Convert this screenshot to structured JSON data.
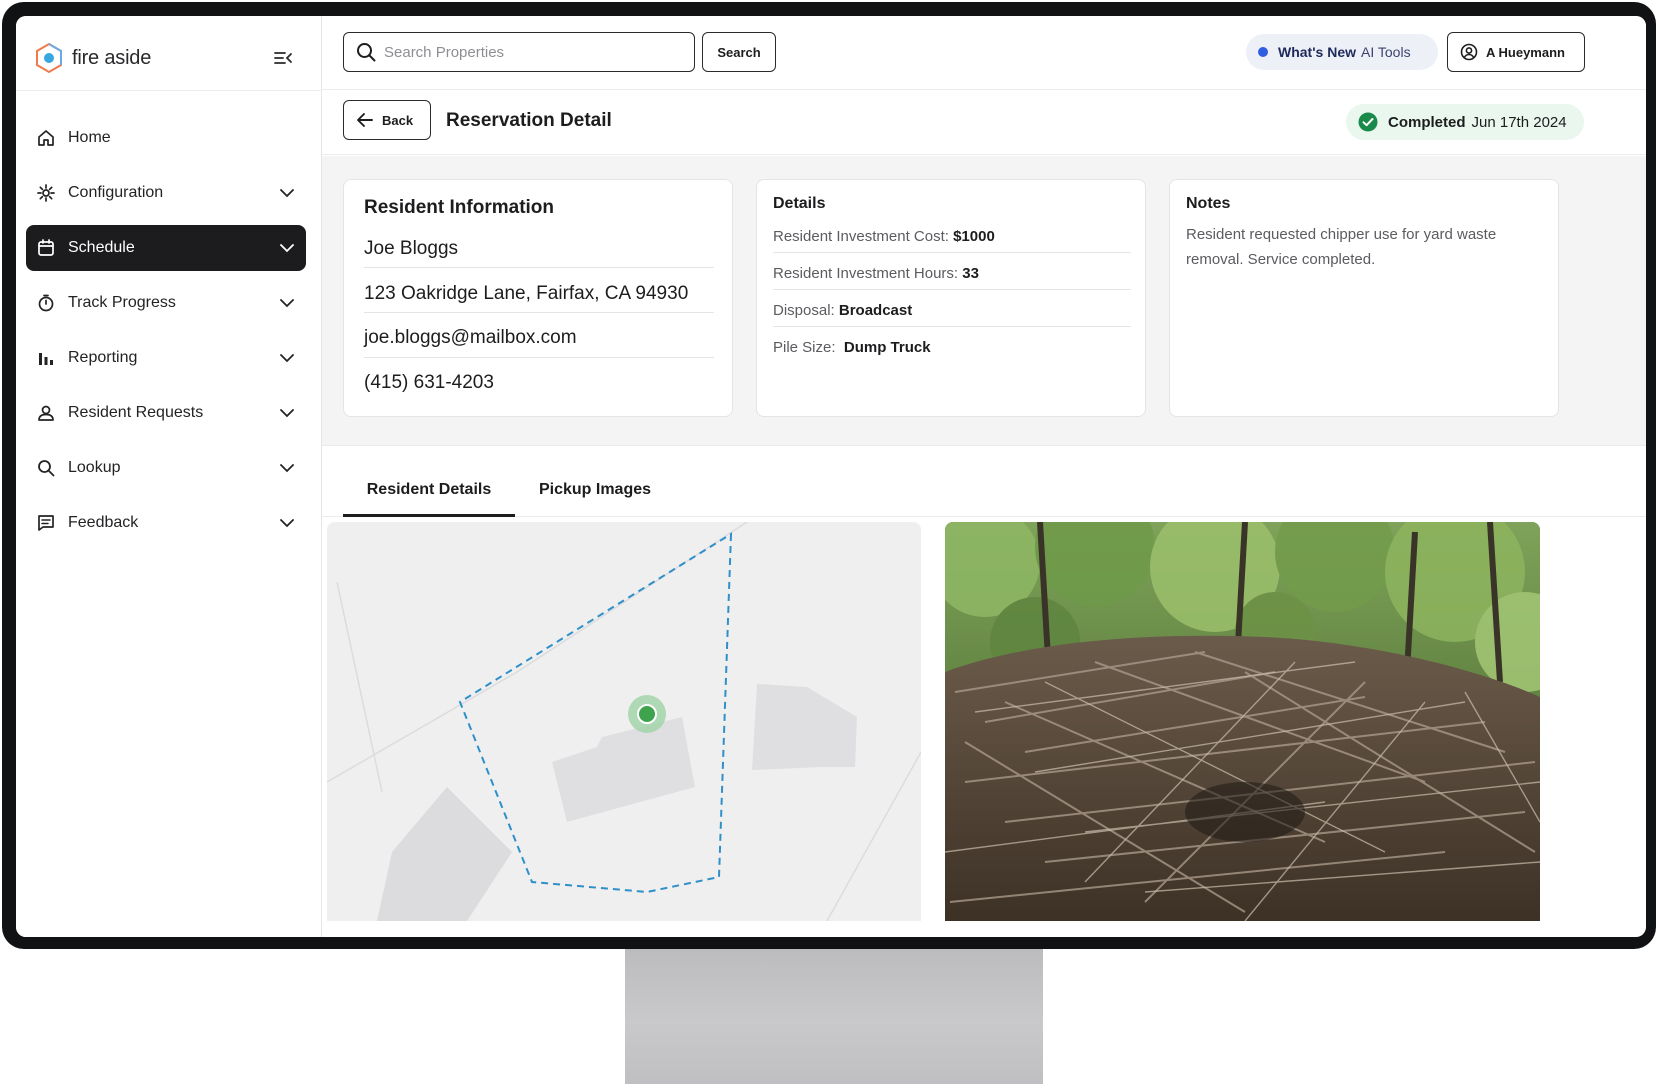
{
  "brand": {
    "name": "fire aside"
  },
  "sidebar": {
    "items": [
      {
        "label": "Home",
        "icon": "home-icon",
        "has_chevron": false
      },
      {
        "label": "Configuration",
        "icon": "gear-icon",
        "has_chevron": true
      },
      {
        "label": "Schedule",
        "icon": "calendar-icon",
        "has_chevron": true,
        "active": true
      },
      {
        "label": "Track Progress",
        "icon": "stopwatch-icon",
        "has_chevron": true
      },
      {
        "label": "Reporting",
        "icon": "bar-chart-icon",
        "has_chevron": true
      },
      {
        "label": "Resident Requests",
        "icon": "user-icon",
        "has_chevron": true
      },
      {
        "label": "Lookup",
        "icon": "search-icon",
        "has_chevron": true
      },
      {
        "label": "Feedback",
        "icon": "feedback-icon",
        "has_chevron": true
      }
    ]
  },
  "header": {
    "search_placeholder": "Search Properties",
    "search_button": "Search",
    "whats_new_strong": "What's New",
    "whats_new_light": "AI Tools",
    "user_name": "A Hueymann"
  },
  "subheader": {
    "back_label": "Back",
    "title": "Reservation Detail",
    "status_label": "Completed",
    "status_date": "Jun 17th 2024"
  },
  "resident": {
    "title": "Resident Information",
    "name": "Joe Bloggs",
    "address": "123 Oakridge Lane, Fairfax, CA 94930",
    "email": "joe.bloggs@mailbox.com",
    "phone": "(415) 631-4203"
  },
  "details": {
    "title": "Details",
    "rows": [
      {
        "label": "Resident Investment Cost:",
        "value": "$1000"
      },
      {
        "label": "Resident Investment Hours:",
        "value": "33"
      },
      {
        "label": "Disposal:",
        "value": "Broadcast"
      },
      {
        "label": "Pile Size:",
        "value": "Dump Truck"
      }
    ]
  },
  "notes": {
    "title": "Notes",
    "text": "Resident requested chipper use for yard waste removal. Service completed."
  },
  "tabs": [
    {
      "label": "Resident Details",
      "active": true
    },
    {
      "label": "Pickup Images",
      "active": false
    }
  ],
  "colors": {
    "active_nav": "#1c1c1e",
    "status_green": "#1a8a4a",
    "status_bg": "#e9f7ee",
    "whats_new_dot": "#2f5fe0",
    "property_line": "#2f8fc9",
    "map_pin": "#3fa34d"
  }
}
